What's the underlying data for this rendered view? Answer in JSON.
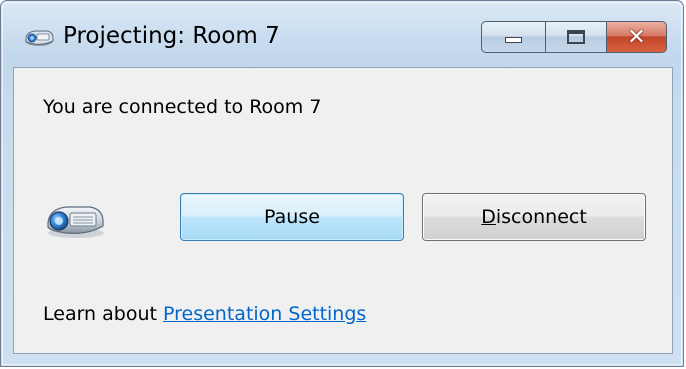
{
  "window": {
    "title": "Projecting: Room 7"
  },
  "titlebar": {
    "icon": "projector-small-icon",
    "buttons": {
      "minimize": "minimize-icon",
      "maximize": "maximize-icon",
      "close": "close-icon"
    }
  },
  "content": {
    "status_text": "You are connected to Room 7",
    "projector_icon": "projector-icon",
    "pause_label": "Pause",
    "disconnect_mnemonic": "D",
    "disconnect_rest": "isconnect",
    "learn_prefix": "Learn about ",
    "learn_link": "Presentation Settings"
  },
  "colors": {
    "link": "#0066cc",
    "focused_button_border": "#3c7fb1",
    "close_button": "#c2462b"
  }
}
